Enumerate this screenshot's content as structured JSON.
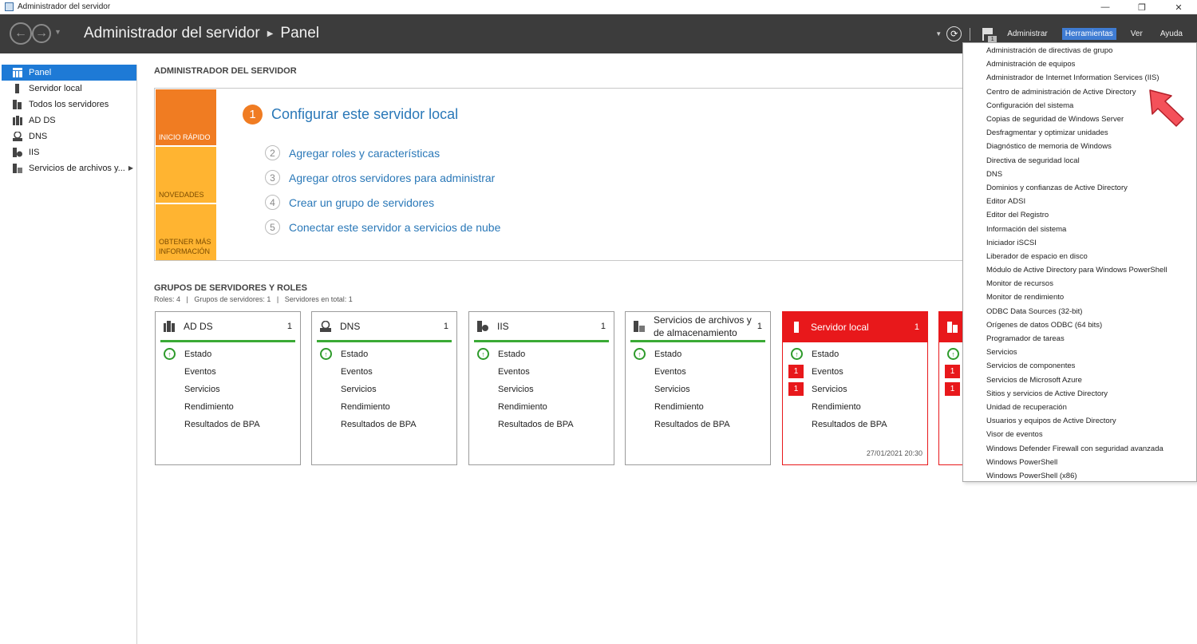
{
  "window": {
    "title": "Administrador del servidor",
    "minimize": "—",
    "restore": "❐",
    "close": "✕"
  },
  "header": {
    "app": "Administrador del servidor",
    "page": "Panel",
    "flag_count": "1",
    "menus": [
      {
        "label": "Administrar",
        "active": false
      },
      {
        "label": "Herramientas",
        "active": true
      },
      {
        "label": "Ver",
        "active": false
      },
      {
        "label": "Ayuda",
        "active": false
      }
    ]
  },
  "sidebar": {
    "items": [
      {
        "label": "Panel",
        "icon": "grid-icon",
        "active": true
      },
      {
        "label": "Servidor local",
        "icon": "server-icon"
      },
      {
        "label": "Todos los servidores",
        "icon": "servers-icon"
      },
      {
        "label": "AD DS",
        "icon": "adds-icon"
      },
      {
        "label": "DNS",
        "icon": "dns-icon"
      },
      {
        "label": "IIS",
        "icon": "iis-icon"
      },
      {
        "label": "Servicios de archivos y...",
        "icon": "file-services-icon",
        "expandable": true
      }
    ]
  },
  "main": {
    "title": "ADMINISTRADOR DEL SERVIDOR",
    "tiles": [
      "INICIO RÁPIDO",
      "NOVEDADES",
      "OBTENER MÁS INFORMACIÓN"
    ],
    "configure": {
      "num": "1",
      "label": "Configurar este servidor local"
    },
    "steps": [
      {
        "num": "2",
        "label": "Agregar roles y características"
      },
      {
        "num": "3",
        "label": "Agregar otros servidores para administrar"
      },
      {
        "num": "4",
        "label": "Crear un grupo de servidores"
      },
      {
        "num": "5",
        "label": "Conectar este servidor a servicios de nube"
      }
    ],
    "groups_title": "GRUPOS DE SERVIDORES Y ROLES",
    "groups_sub": "Roles: 4   |   Grupos de servidores: 1   |   Servidores en total: 1"
  },
  "cards": [
    {
      "title": "AD DS",
      "count": "1",
      "red": false,
      "rows": [
        {
          "label": "Estado",
          "mark": "ok"
        },
        {
          "label": "Eventos"
        },
        {
          "label": "Servicios"
        },
        {
          "label": "Rendimiento"
        },
        {
          "label": "Resultados de BPA"
        }
      ]
    },
    {
      "title": "DNS",
      "count": "1",
      "red": false,
      "rows": [
        {
          "label": "Estado",
          "mark": "ok"
        },
        {
          "label": "Eventos"
        },
        {
          "label": "Servicios"
        },
        {
          "label": "Rendimiento"
        },
        {
          "label": "Resultados de BPA"
        }
      ]
    },
    {
      "title": "IIS",
      "count": "1",
      "red": false,
      "rows": [
        {
          "label": "Estado",
          "mark": "ok"
        },
        {
          "label": "Eventos"
        },
        {
          "label": "Servicios"
        },
        {
          "label": "Rendimiento"
        },
        {
          "label": "Resultados de BPA"
        }
      ]
    },
    {
      "title": "Servicios de archivos y de almacenamiento",
      "count": "1",
      "red": false,
      "rows": [
        {
          "label": "Estado",
          "mark": "ok"
        },
        {
          "label": "Eventos"
        },
        {
          "label": "Servicios"
        },
        {
          "label": "Rendimiento"
        },
        {
          "label": "Resultados de BPA"
        }
      ]
    },
    {
      "title": "Servidor local",
      "count": "1",
      "red": true,
      "date": "27/01/2021 20:30",
      "rows": [
        {
          "label": "Estado",
          "mark": "ok"
        },
        {
          "label": "Eventos",
          "badge": "1"
        },
        {
          "label": "Servicios",
          "badge": "1"
        },
        {
          "label": "Rendimiento"
        },
        {
          "label": "Resultados de BPA"
        }
      ]
    }
  ],
  "tools_menu": [
    "Administración de directivas de grupo",
    "Administración de equipos",
    "Administrador de Internet Information Services (IIS)",
    "Centro de administración de Active Directory",
    "Configuración del sistema",
    "Copias de seguridad de Windows Server",
    "Desfragmentar y optimizar unidades",
    "Diagnóstico de memoria de Windows",
    "Directiva de seguridad local",
    "DNS",
    "Dominios y confianzas de Active Directory",
    "Editor ADSI",
    "Editor del Registro",
    "Información del sistema",
    "Iniciador iSCSI",
    "Liberador de espacio en disco",
    "Módulo de Active Directory para Windows PowerShell",
    "Monitor de recursos",
    "Monitor de rendimiento",
    "ODBC Data Sources (32-bit)",
    "Orígenes de datos ODBC (64 bits)",
    "Programador de tareas",
    "Servicios",
    "Servicios de componentes",
    "Servicios de Microsoft Azure",
    "Sitios y servicios de Active Directory",
    "Unidad de recuperación",
    "Usuarios y equipos de Active Directory",
    "Visor de eventos",
    "Windows Defender Firewall con seguridad avanzada",
    "Windows PowerShell",
    "Windows PowerShell (x86)"
  ],
  "colors": {
    "accent": "#1e7ad6",
    "orange": "#f07c22",
    "yellow": "#ffb431",
    "ok": "#3aaa35",
    "alert": "#e8181b",
    "header": "#3c3c3c"
  }
}
